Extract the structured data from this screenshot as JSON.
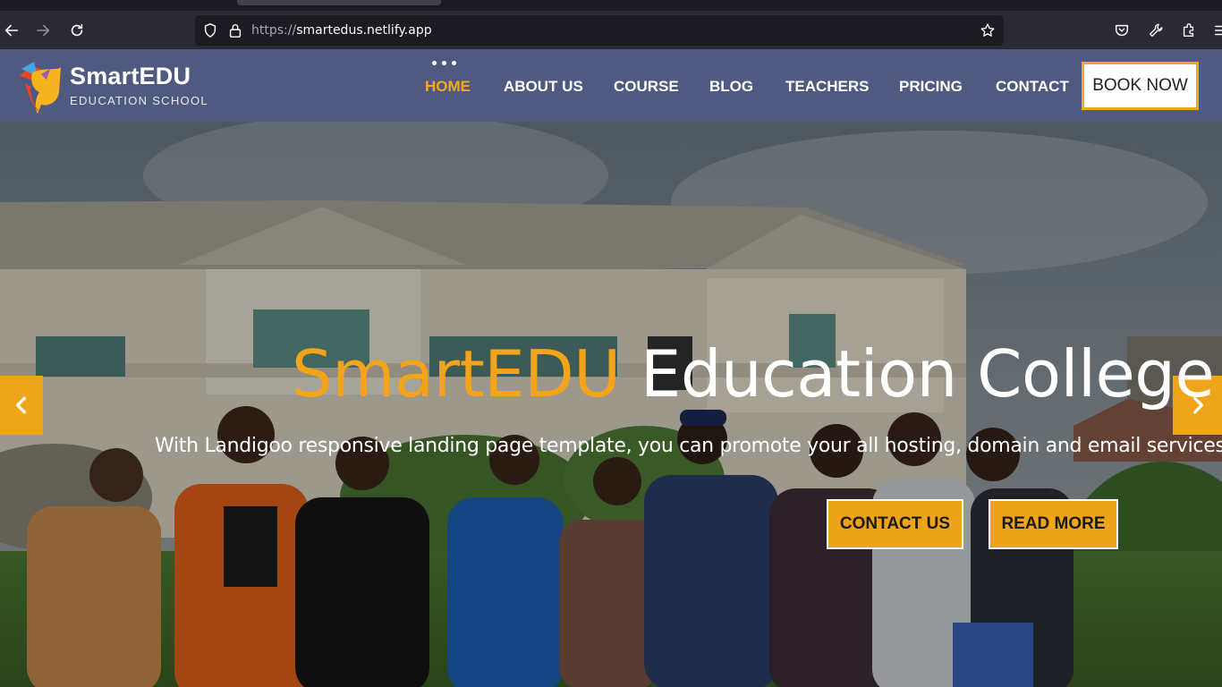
{
  "browser": {
    "url_protocol": "https://",
    "url_host": "smartedus.netlify.app"
  },
  "site": {
    "logo": {
      "title": "SmartEDU",
      "subtitle": "EDUCATION SCHOOL"
    },
    "nav": [
      {
        "label": "HOME",
        "active": true
      },
      {
        "label": "ABOUT US",
        "active": false
      },
      {
        "label": "COURSE",
        "active": false
      },
      {
        "label": "BLOG",
        "active": false
      },
      {
        "label": "TEACHERS",
        "active": false
      },
      {
        "label": "PRICING",
        "active": false
      },
      {
        "label": "CONTACT",
        "active": false
      }
    ],
    "book_button": "BOOK NOW"
  },
  "hero": {
    "title_accent": "SmartEDU",
    "title_rest": " Education College",
    "subtitle": "With Landigoo responsive landing page template, you can promote your all hosting, domain and email services.",
    "contact_button": "CONTACT US",
    "read_more_button": "READ MORE"
  },
  "colors": {
    "accent": "#f4a41a",
    "navbar": "#505a80",
    "browser_toolbar": "#2b2a33"
  },
  "icons": [
    "back-icon",
    "forward-icon",
    "reload-icon",
    "shield-icon",
    "lock-icon",
    "star-icon",
    "pocket-icon",
    "wrench-icon",
    "extensions-icon",
    "menu-icon",
    "chevron-left-icon",
    "chevron-right-icon"
  ]
}
